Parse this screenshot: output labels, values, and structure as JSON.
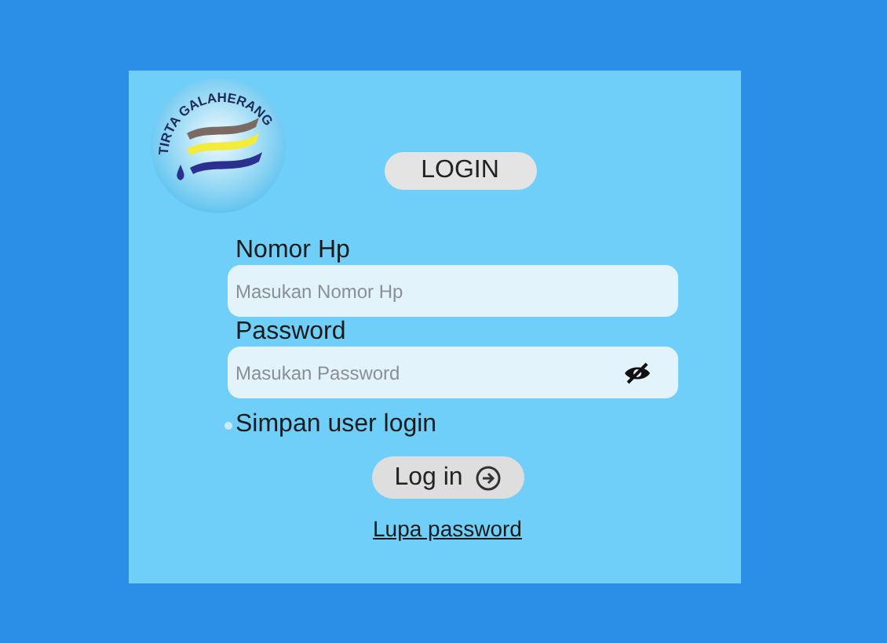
{
  "logo": {
    "text": "TIRTA GALAHERANG"
  },
  "title": "LOGIN",
  "fields": [
    {
      "label": "Nomor Hp",
      "placeholder": "Masukan Nomor Hp",
      "kind": "text"
    },
    {
      "label": "Password",
      "placeholder": "Masukan Password",
      "kind": "password"
    }
  ],
  "remember": {
    "label": "Simpan user login",
    "checked": false
  },
  "login_button": "Log in",
  "forgot_link": "Lupa password"
}
